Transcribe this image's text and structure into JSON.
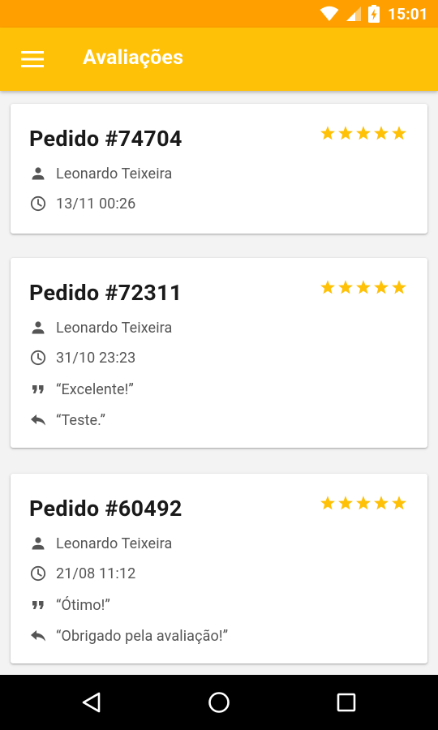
{
  "status_bar": {
    "time": "15:01"
  },
  "app_bar": {
    "title": "Avaliações",
    "menu_icon": "hamburger-menu-icon"
  },
  "theme": {
    "primary": "#ffc107",
    "primary_dark": "#ffa000",
    "star": "#ffc107"
  },
  "reviews": [
    {
      "title": "Pedido #74704",
      "stars": 5,
      "customer": "Leonardo Teixeira",
      "datetime": "13/11 00:26"
    },
    {
      "title": "Pedido #72311",
      "stars": 5,
      "customer": "Leonardo Teixeira",
      "datetime": "31/10 23:23",
      "comment": "“Excelente!”",
      "reply": "“Teste.”"
    },
    {
      "title": "Pedido #60492",
      "stars": 5,
      "customer": "Leonardo Teixeira",
      "datetime": "21/08 11:12",
      "comment": "“Ótimo!”",
      "reply": "“Obrigado pela avaliação!”"
    }
  ],
  "icons": {
    "customer": "person-icon",
    "datetime": "clock-icon",
    "comment": "quote-icon",
    "reply": "reply-icon",
    "rating": "star-icon"
  },
  "nav": {
    "back": "back-triangle-icon",
    "home": "home-circle-icon",
    "recents": "recents-square-icon"
  }
}
